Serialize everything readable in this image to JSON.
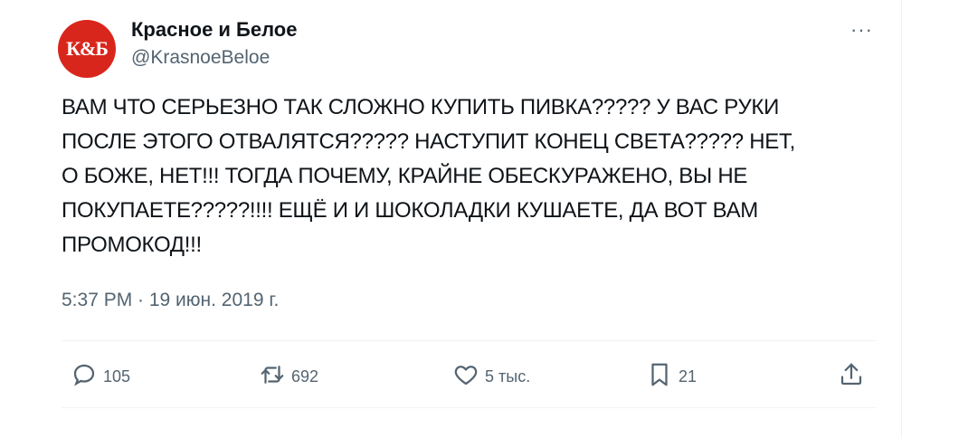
{
  "author": {
    "avatar_text": "К&Б",
    "name": "Красное и Белое",
    "handle": "@KrasnoeBeloe"
  },
  "more_label": "···",
  "tweet": {
    "text": "ВАМ ЧТО СЕРЬЕЗНО ТАК СЛОЖНО КУПИТЬ ПИВКА????? У ВАС РУКИ\nПОСЛЕ ЭТОГО ОТВАЛЯТСЯ????? НАСТУПИТ КОНЕЦ СВЕТА????? НЕТ,\nО БОЖЕ, НЕТ!!! ТОГДА ПОЧЕМУ, КРАЙНЕ ОБЕСКУРАЖЕНО, ВЫ НЕ\nПОКУПАЕТЕ?????!!!! ЕЩЁ И И ШОКОЛАДКИ КУШАЕТЕ, ДА ВОТ ВАМ\nПРОМОКОД!!!",
    "timestamp": "5:37 PM · 19 июн. 2019 г."
  },
  "actions": {
    "replies": "105",
    "retweets": "692",
    "likes": "5 тыс.",
    "bookmarks": "21"
  },
  "colors": {
    "text": "#0f1419",
    "secondary": "#536471",
    "divider": "#eff3f4",
    "avatar": "#d9261c"
  }
}
